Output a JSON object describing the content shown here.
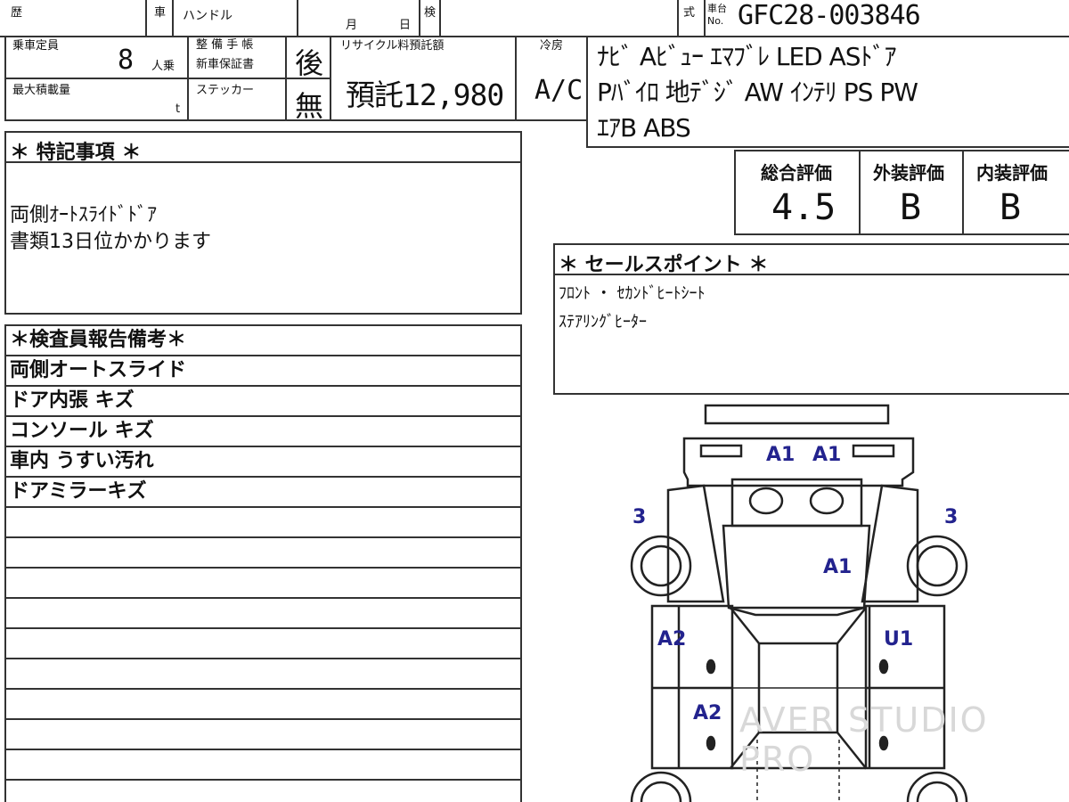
{
  "header": {
    "reki_label": "歴",
    "sha_label": "車",
    "handle_label": "ハンドル",
    "month_label": "月",
    "day_label": "日",
    "ken_label": "検",
    "shiki_label": "式",
    "chassis_label_top": "車台",
    "chassis_label_bottom": "No.",
    "chassis_number": "GFC28-003846"
  },
  "spec": {
    "capacity_label": "乗車定員",
    "capacity_value": "8",
    "capacity_unit": "人乗",
    "maint_label_1": "整 備 手 帳",
    "maint_label_2": "新車保証書",
    "maint_value": "後",
    "load_label": "最大積載量",
    "load_unit": "t",
    "sticker_label": "ステッカー",
    "sticker_value": "無",
    "recycle_label": "リサイクル料預託額",
    "recycle_value": "預託12,980",
    "ac_label": "冷房",
    "ac_value": "A/C",
    "equipment_lines": [
      "ﾅﾋﾞ Aﾋﾞｭｰ ｴﾏﾌﾞﾚ LED ASﾄﾞｱ",
      "Pﾊﾞｲﾛ 地ﾃﾞｼﾞ AW ｲﾝﾃﾘ PS PW",
      "ｴｱB ABS"
    ]
  },
  "special_notes": {
    "title": "＊ 特記事項 ＊",
    "lines": [
      "両側ｵｰﾄｽﾗｲﾄﾞﾄﾞｱ",
      "書類13日位かかります"
    ]
  },
  "grades": {
    "overall_label": "総合評価",
    "overall_value": "4.5",
    "exterior_label": "外装評価",
    "exterior_value": "B",
    "interior_label": "内装評価",
    "interior_value": "B"
  },
  "sales_points": {
    "title": "＊ セールスポイント ＊",
    "lines": [
      "ﾌﾛﾝﾄ ・ ｾｶﾝﾄﾞﾋｰﾄｼｰﾄ",
      "ｽﾃｱﾘﾝｸﾞﾋｰﾀｰ"
    ]
  },
  "inspector": {
    "title": "＊検査員報告備考＊",
    "lines": [
      "両側オートスライド",
      "ドア内張 キズ",
      "コンソール キズ",
      "車内 うすい汚れ",
      "ドアミラーキズ"
    ]
  },
  "diagram_marks": {
    "hood_left": "A1",
    "hood_right": "A1",
    "front_left_corner": "3",
    "front_right_corner": "3",
    "roof_right": "A1",
    "left_front_door": "A2",
    "right_front_door": "U1",
    "left_rear_door": "A2"
  },
  "watermark": "AVER STUDIO PRO"
}
